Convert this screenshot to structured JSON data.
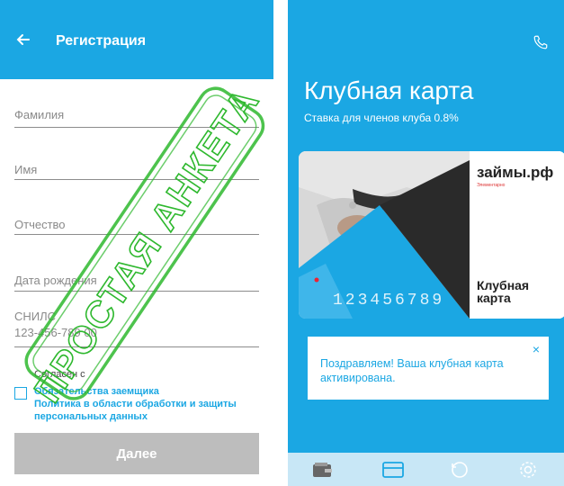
{
  "left": {
    "title": "Регистрация",
    "fields": [
      {
        "label": "Фамилия",
        "value": ""
      },
      {
        "label": "Имя",
        "value": ""
      },
      {
        "label": "Отчество",
        "value": ""
      },
      {
        "label": "Дата рождения",
        "value": ""
      },
      {
        "label": "СНИЛС",
        "value": "123-456-789 00"
      }
    ],
    "agree_prefix": "Согласен с",
    "agree_links": [
      "Обязательства заемщика",
      "Политика в области обработки и защиты",
      "персональных данных"
    ],
    "next_label": "Далее",
    "stamp_text": "ПРОСТАЯ АНКЕТА",
    "stamp_color": "#2eb82e",
    "accent": "#1ba7e3"
  },
  "right": {
    "title": "Клубная карта",
    "rate": "Ставка для членов клуба 0.8%",
    "card": {
      "brand": "займы.рф",
      "brand_sub": "Элементарно",
      "number": "123456789",
      "name": "Клубная карта"
    },
    "notice": "Поздравляем! Ваша клубная карта активирована.",
    "close_icon": "×",
    "nav": [
      "wallet-icon",
      "card-icon",
      "history-icon",
      "settings-icon"
    ]
  }
}
